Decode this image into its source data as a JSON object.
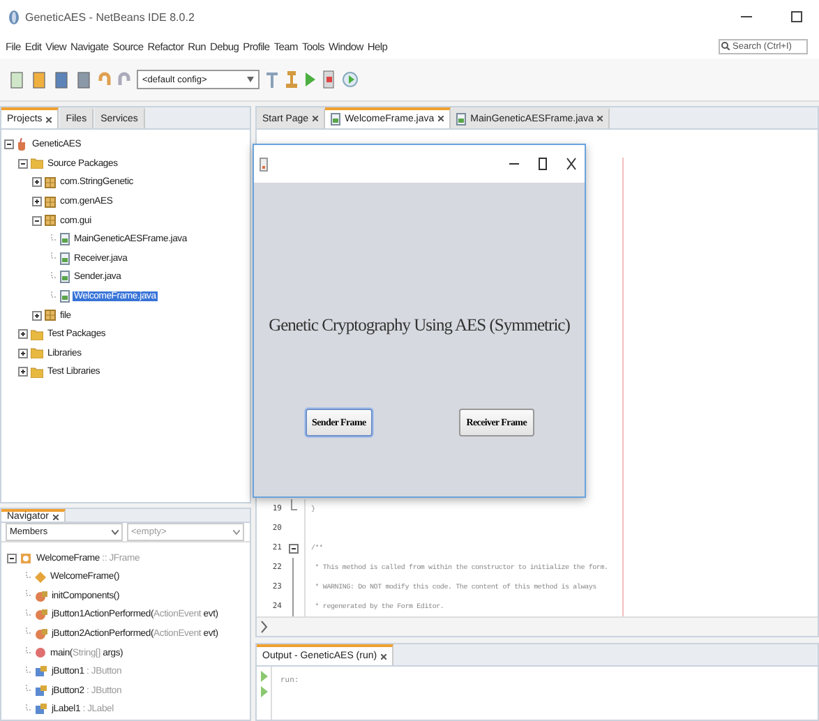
{
  "window": {
    "title": "GeneticAES - NetBeans IDE 8.0.2"
  },
  "menu": [
    "File",
    "Edit",
    "View",
    "Navigate",
    "Source",
    "Refactor",
    "Run",
    "Debug",
    "Profile",
    "Team",
    "Tools",
    "Window",
    "Help"
  ],
  "toolbar": {
    "config": "<default config>"
  },
  "search": {
    "placeholder": "Search (Ctrl+I)"
  },
  "project_tabs": [
    {
      "label": "Projects",
      "selected": true,
      "closable": true
    },
    {
      "label": "Files",
      "selected": false,
      "closable": false
    },
    {
      "label": "Services",
      "selected": false,
      "closable": false
    }
  ],
  "project_tree": [
    {
      "label": "GeneticAES",
      "kind": "project",
      "expanded": true,
      "selected": false,
      "children": [
        {
          "label": "Source Packages",
          "kind": "folder",
          "expanded": true,
          "selected": false,
          "children": [
            {
              "label": "com.StringGenetic",
              "kind": "package",
              "expanded": false,
              "selected": false
            },
            {
              "label": "com.genAES",
              "kind": "package",
              "expanded": false,
              "selected": false
            },
            {
              "label": "com.gui",
              "kind": "package",
              "expanded": true,
              "selected": false,
              "children": [
                {
                  "label": "MainGeneticAESFrame.java",
                  "kind": "file",
                  "selected": false
                },
                {
                  "label": "Receiver.java",
                  "kind": "file",
                  "selected": false
                },
                {
                  "label": "Sender.java",
                  "kind": "file",
                  "selected": false
                },
                {
                  "label": "WelcomeFrame.java",
                  "kind": "file",
                  "selected": true
                }
              ]
            },
            {
              "label": "file",
              "kind": "package",
              "expanded": false,
              "selected": false
            }
          ]
        },
        {
          "label": "Test Packages",
          "kind": "folder",
          "expanded": false,
          "selected": false
        },
        {
          "label": "Libraries",
          "kind": "folder",
          "expanded": false,
          "selected": false
        },
        {
          "label": "Test Libraries",
          "kind": "folder",
          "expanded": false,
          "selected": false
        }
      ]
    }
  ],
  "editor_tabs": [
    {
      "label": "Start Page",
      "kind": "page",
      "selected": false
    },
    {
      "label": "WelcomeFrame.java",
      "kind": "java",
      "selected": true
    },
    {
      "label": "MainGeneticAESFrame.java",
      "kind": "java",
      "selected": false
    }
  ],
  "code_lines": [
    {
      "number": "19",
      "text": "}",
      "kind": "fold-end"
    },
    {
      "number": "20",
      "kind": "plain"
    },
    {
      "number": "21",
      "text": "/**",
      "kind": "fold-start"
    },
    {
      "number": "22",
      "text": " * This method is called from within the constructor to initialize the form.",
      "kind": "fold-body"
    },
    {
      "number": "23",
      "text": " * WARNING: Do NOT modify this code. The content of this method is always",
      "kind": "fold-body"
    },
    {
      "number": "24",
      "text": " * regenerated by the Form Editor.",
      "kind": "fold-body"
    }
  ],
  "navigator": {
    "title": "Navigator",
    "filter": "Members",
    "filter_value": "<empty>",
    "tree": [
      {
        "kind": "class",
        "expanded": true,
        "parts": [
          {
            "text": "WelcomeFrame",
            "muted": false
          },
          {
            "text": " :: JFrame",
            "muted": true
          }
        ],
        "children": [
          {
            "kind": "constructor",
            "parts": [
              {
                "text": "WelcomeFrame()",
                "muted": false
              }
            ]
          },
          {
            "kind": "private-method",
            "parts": [
              {
                "text": "initComponents()",
                "muted": false
              }
            ]
          },
          {
            "kind": "private-method",
            "parts": [
              {
                "text": "jButton1ActionPerformed(",
                "muted": false
              },
              {
                "text": "ActionEvent",
                "muted": true
              },
              {
                "text": " evt)",
                "muted": false
              }
            ]
          },
          {
            "kind": "private-method",
            "parts": [
              {
                "text": "jButton2ActionPerformed(",
                "muted": false
              },
              {
                "text": "ActionEvent",
                "muted": true
              },
              {
                "text": " evt)",
                "muted": false
              }
            ]
          },
          {
            "kind": "static-method",
            "parts": [
              {
                "text": "main(",
                "muted": false
              },
              {
                "text": "String[]",
                "muted": true
              },
              {
                "text": " args)",
                "muted": false
              }
            ]
          },
          {
            "kind": "field",
            "parts": [
              {
                "text": "jButton1",
                "muted": false
              },
              {
                "text": " : JButton",
                "muted": true
              }
            ]
          },
          {
            "kind": "field",
            "parts": [
              {
                "text": "jButton2",
                "muted": false
              },
              {
                "text": " : JButton",
                "muted": true
              }
            ]
          },
          {
            "kind": "field",
            "parts": [
              {
                "text": "jLabel1",
                "muted": false
              },
              {
                "text": " : JLabel",
                "muted": true
              }
            ]
          }
        ]
      }
    ]
  },
  "output": {
    "title": "Output - GeneticAES (run)",
    "lines": [
      "run:"
    ]
  },
  "frame": {
    "heading": "Genetic Cryptography Using AES (Symmetric)",
    "buttons": [
      {
        "label": "Sender Frame",
        "focused": true
      },
      {
        "label": "Receiver Frame",
        "focused": false
      }
    ]
  }
}
